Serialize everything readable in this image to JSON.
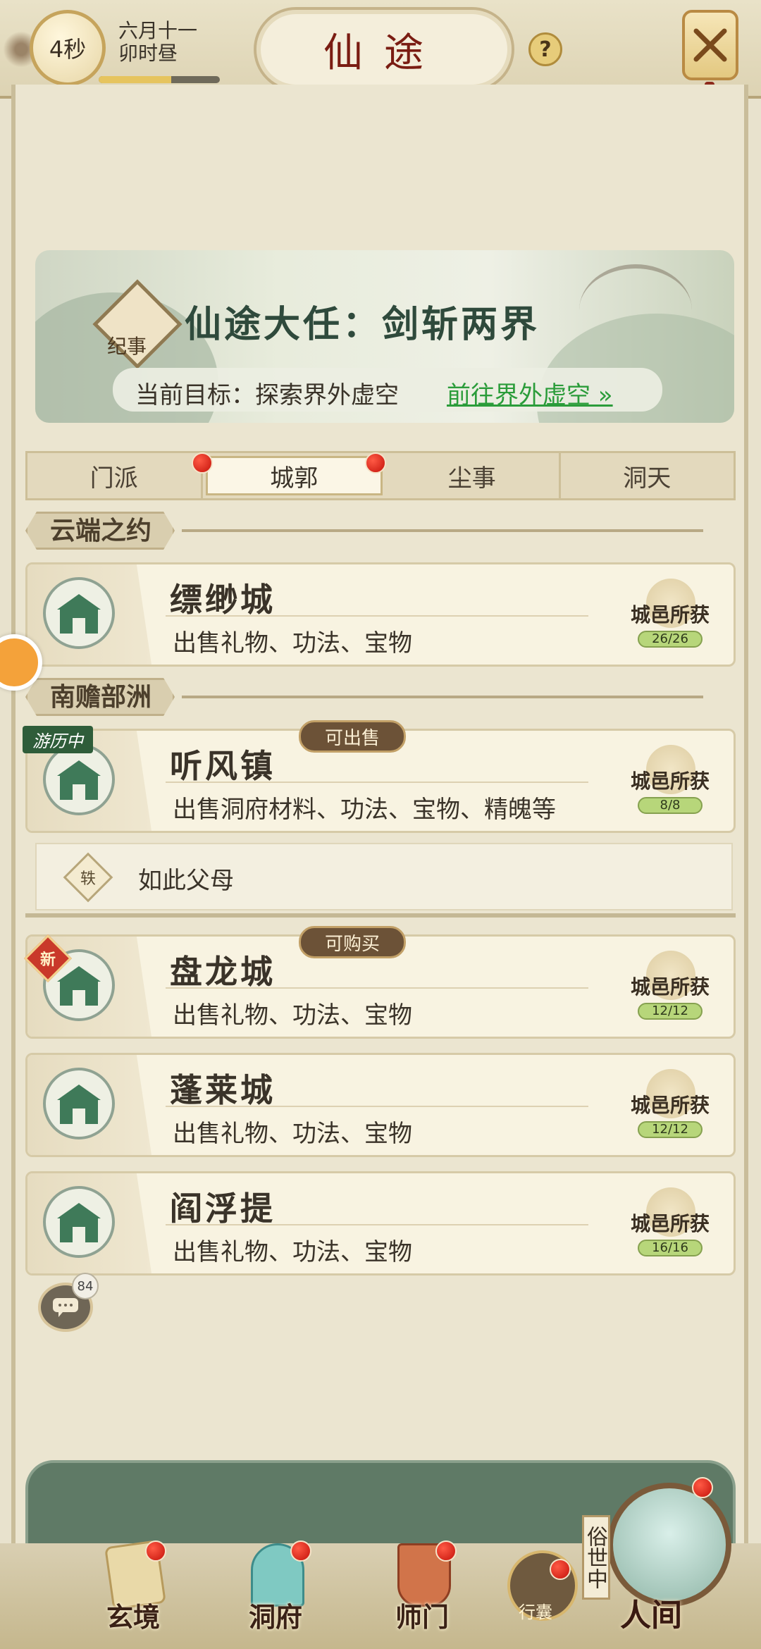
{
  "header": {
    "timer": "4秒",
    "date_line1": "六月十一",
    "date_line2": "卯时昼",
    "time_progress": 0.6,
    "title": "仙途",
    "help_label": "?"
  },
  "banner": {
    "emblem_label": "纪事",
    "title": "仙途大任：剑斩两界",
    "goal_label": "当前目标：探索界外虚空",
    "goal_link": "前往界外虚空"
  },
  "tabs": [
    {
      "label": "门派",
      "badge": true
    },
    {
      "label": "城郭",
      "badge": true,
      "active": true
    },
    {
      "label": "尘事",
      "badge": false
    },
    {
      "label": "洞天",
      "badge": false
    }
  ],
  "sections": [
    {
      "title": "云端之约"
    },
    {
      "title": "南赡部洲"
    }
  ],
  "cities": [
    {
      "name": "缥缈城",
      "desc": "出售礼物、功法、宝物",
      "reward_label": "城邑所获",
      "reward_count": "26/26"
    },
    {
      "name": "听风镇",
      "desc": "出售洞府材料、功法、宝物、精魄等",
      "reward_label": "城邑所获",
      "reward_count": "8/8",
      "status": "游历中",
      "pill": "可出售"
    },
    {
      "name": "盘龙城",
      "desc": "出售礼物、功法、宝物",
      "reward_label": "城邑所获",
      "reward_count": "12/12",
      "new_badge": "新",
      "pill": "可购买"
    },
    {
      "name": "蓬莱城",
      "desc": "出售礼物、功法、宝物",
      "reward_label": "城邑所获",
      "reward_count": "12/12"
    },
    {
      "name": "阎浮提",
      "desc": "出售礼物、功法、宝物",
      "reward_label": "城邑所获",
      "reward_count": "16/16"
    }
  ],
  "subitem": {
    "icon_text": "轶",
    "text": "如此父母"
  },
  "chat": {
    "count": "84"
  },
  "bottom_nav": [
    {
      "label": "玄境"
    },
    {
      "label": "洞府"
    },
    {
      "label": "师门"
    }
  ],
  "bag": {
    "label": "行囊"
  },
  "realm": {
    "tag": "俗世中",
    "label": "人间"
  },
  "colors": {
    "accent_red": "#c4120a",
    "link_green": "#2b9c3a",
    "title_red": "#7a1c12"
  }
}
